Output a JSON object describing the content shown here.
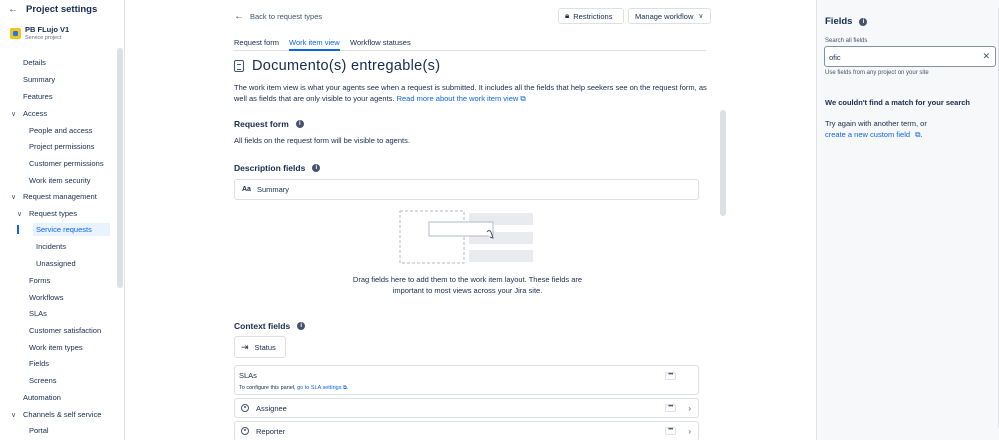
{
  "sidebar": {
    "title": "Project settings",
    "project_name": "PB FLujo V1",
    "project_type": "Service project",
    "items": [
      {
        "label": "Details",
        "chev": ""
      },
      {
        "label": "Summary",
        "chev": ""
      },
      {
        "label": "Features",
        "chev": ""
      },
      {
        "label": "Access",
        "chev": "∨"
      },
      {
        "label": "People and access",
        "chev": ""
      },
      {
        "label": "Project permissions",
        "chev": ""
      },
      {
        "label": "Customer permissions",
        "chev": ""
      },
      {
        "label": "Work item security",
        "chev": ""
      },
      {
        "label": "Request management",
        "chev": "∨"
      },
      {
        "label": "Request types",
        "chev": "∨"
      },
      {
        "label": "Service requests",
        "chev": ""
      },
      {
        "label": "Incidents",
        "chev": ""
      },
      {
        "label": "Unassigned",
        "chev": ""
      },
      {
        "label": "Forms",
        "chev": ""
      },
      {
        "label": "Workflows",
        "chev": ""
      },
      {
        "label": "SLAs",
        "chev": ""
      },
      {
        "label": "Customer satisfaction",
        "chev": ""
      },
      {
        "label": "Work item types",
        "chev": ""
      },
      {
        "label": "Fields",
        "chev": ""
      },
      {
        "label": "Screens",
        "chev": ""
      },
      {
        "label": "Automation",
        "chev": ""
      },
      {
        "label": "Channels & self service",
        "chev": "∨"
      },
      {
        "label": "Portal",
        "chev": ""
      }
    ]
  },
  "main": {
    "back_label": "Back to request types",
    "restrictions_label": "Restrictions",
    "manage_workflow_label": "Manage workflow",
    "tabs": [
      {
        "label": "Request form"
      },
      {
        "label": "Work item view"
      },
      {
        "label": "Workflow statuses"
      }
    ],
    "heading": "Documento(s) entregable(s)",
    "description": "The work item view is what your agents see when a request is submitted. It includes all the fields that help seekers see on the request form, as well as fields that are only visible to your agents.",
    "read_more": "Read more about the work item view",
    "request_form_title": "Request form",
    "request_form_text": "All fields on the request form will be visible to agents.",
    "description_fields_title": "Description fields",
    "summary_field": "Summary",
    "drop_text": "Drag fields here to add them to the work item layout. These fields are important to most views across your Jira site.",
    "context_fields_title": "Context fields",
    "status_label": "Status",
    "slas_label": "SLAs",
    "slas_configure_prefix": "To configure this panel,",
    "slas_configure_link": "go to SLA settings",
    "assignee_label": "Assignee",
    "reporter_label": "Reporter"
  },
  "panel": {
    "title": "Fields",
    "search_label": "Search all fields",
    "search_value": "ofic",
    "hint": "Use fields from any project on your site",
    "no_match": "We couldn't find a match for your search",
    "try_again": "Try again with another term, or",
    "create_link": "create a new custom field"
  },
  "colors": {
    "accent": "#0c66e4",
    "text": "#172b4d",
    "border": "#dcdfe4",
    "panel_bg": "#f7f8f9"
  }
}
